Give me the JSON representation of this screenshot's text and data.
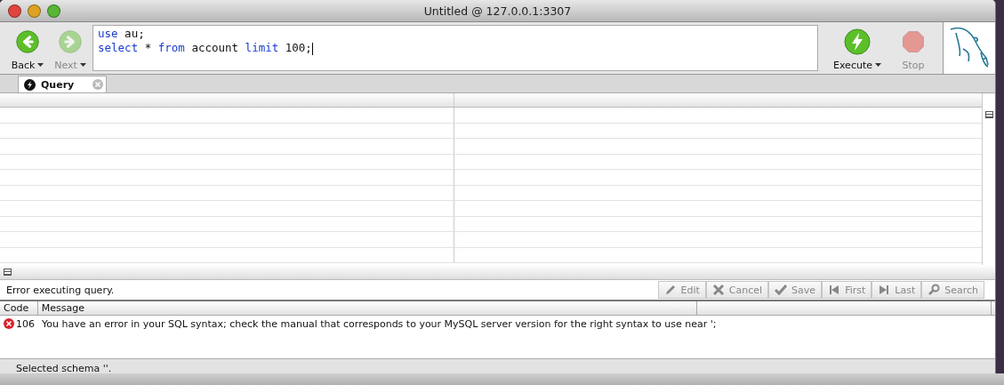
{
  "window": {
    "title": "Untitled @ 127.0.0.1:3307"
  },
  "nav_buttons": [
    {
      "label": "Back",
      "disabled": false,
      "kind": "back"
    },
    {
      "label": "Next",
      "disabled": true,
      "kind": "next"
    }
  ],
  "editor": {
    "lines": [
      [
        {
          "text": "use",
          "kind": "keyword"
        },
        {
          "text": "au",
          "kind": "plain"
        },
        {
          "text": ";",
          "kind": "plain"
        }
      ],
      [
        {
          "text": "select",
          "kind": "keyword"
        },
        {
          "text": "*",
          "kind": "plain"
        },
        {
          "text": "from",
          "kind": "keyword"
        },
        {
          "text": "account",
          "kind": "plain"
        },
        {
          "text": "limit",
          "kind": "keyword"
        },
        {
          "text": "100;",
          "kind": "plain"
        }
      ]
    ]
  },
  "action_buttons": [
    {
      "label": "Execute",
      "disabled": false,
      "kind": "execute"
    },
    {
      "label": "Stop",
      "disabled": true,
      "kind": "stop"
    }
  ],
  "tabs": [
    {
      "label": "Query",
      "selected": true
    }
  ],
  "result_status": "Error executing query.",
  "result_buttons": [
    {
      "label": "Edit",
      "kind": "edit"
    },
    {
      "label": "Cancel",
      "kind": "cancel"
    },
    {
      "label": "Save",
      "kind": "save"
    },
    {
      "label": "First",
      "kind": "first"
    },
    {
      "label": "Last",
      "kind": "last"
    },
    {
      "label": "Search",
      "kind": "search"
    }
  ],
  "messages": {
    "columns": [
      "Code",
      "Message"
    ],
    "rows": [
      {
        "kind": "error",
        "code": "106",
        "message": "You have an error in your SQL syntax; check the manual that corresponds to your MySQL server version for the right syntax to use near ';"
      }
    ]
  },
  "status_bar": "Selected schema ''."
}
